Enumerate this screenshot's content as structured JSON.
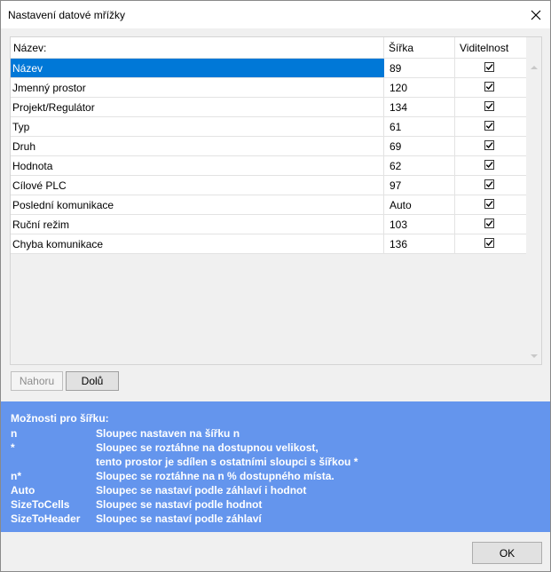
{
  "window": {
    "title": "Nastavení datové mřížky"
  },
  "grid": {
    "columns": {
      "name": "Název:",
      "width": "Šířka",
      "visible": "Viditelnost"
    },
    "rows": [
      {
        "name": "Název",
        "width": "89",
        "visible": true,
        "selected": true
      },
      {
        "name": "Jmenný prostor",
        "width": "120",
        "visible": true
      },
      {
        "name": "Projekt/Regulátor",
        "width": "134",
        "visible": true
      },
      {
        "name": "Typ",
        "width": "61",
        "visible": true
      },
      {
        "name": "Druh",
        "width": "69",
        "visible": true
      },
      {
        "name": "Hodnota",
        "width": "62",
        "visible": true
      },
      {
        "name": "Cílové PLC",
        "width": "97",
        "visible": true
      },
      {
        "name": "Poslední komunikace",
        "width": "Auto",
        "visible": true
      },
      {
        "name": "Ruční režim",
        "width": "103",
        "visible": true
      },
      {
        "name": "Chyba komunikace",
        "width": "136",
        "visible": true
      }
    ]
  },
  "buttons": {
    "up": "Nahoru",
    "down": "Dolů",
    "ok": "OK"
  },
  "info": {
    "heading": "Možnosti pro šířku:",
    "options": [
      {
        "key": "n",
        "desc": "Sloupec nastaven na šířku n"
      },
      {
        "key": "*",
        "desc": "Sloupec se roztáhne na dostupnou velikost,"
      },
      {
        "key": "",
        "desc": "tento prostor je sdílen s ostatními sloupci s šířkou *"
      },
      {
        "key": "n*",
        "desc": "Sloupec se roztáhne na n % dostupného místa."
      },
      {
        "key": "Auto",
        "desc": "Sloupec se nastaví podle záhlaví i hodnot"
      },
      {
        "key": "SizeToCells",
        "desc": "Sloupec se nastaví podle hodnot"
      },
      {
        "key": "SizeToHeader",
        "desc": "Sloupec se nastaví podle záhlaví"
      }
    ]
  },
  "colors": {
    "selection": "#0078d7",
    "info_panel": "#6495ed"
  }
}
